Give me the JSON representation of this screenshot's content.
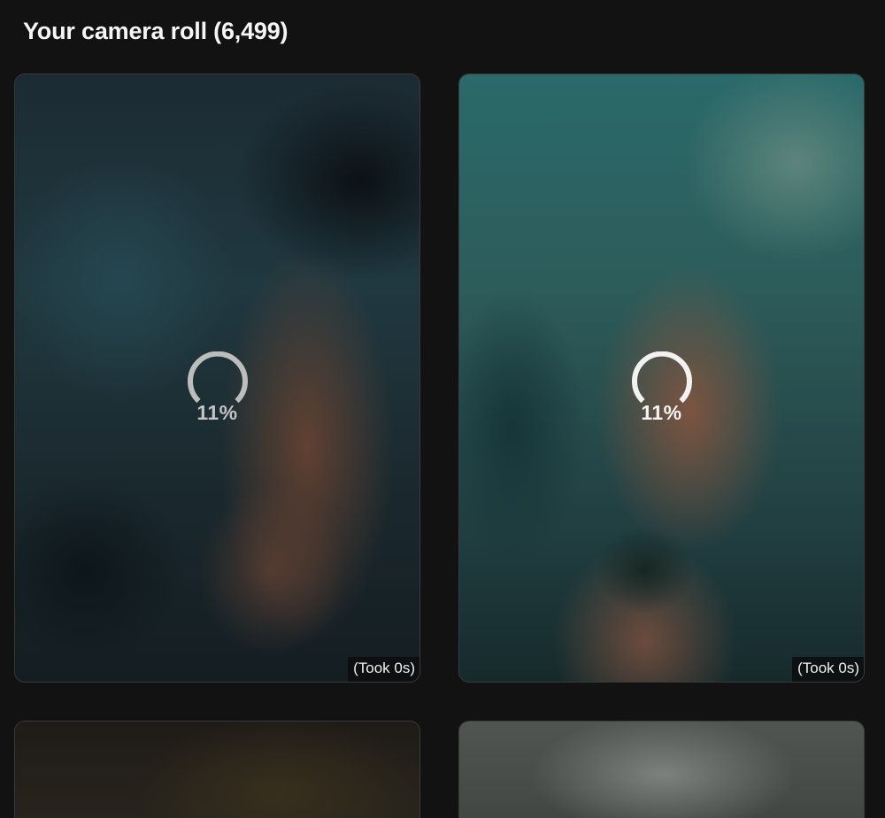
{
  "header": {
    "title": "Your camera roll (6,499)"
  },
  "gallery": {
    "items": [
      {
        "progress_label": "11%",
        "progress_value": 0.11,
        "duration_label": "(Took 0s)",
        "state": "loading"
      },
      {
        "progress_label": "11%",
        "progress_value": 0.11,
        "duration_label": "(Took 0s)",
        "state": "loading"
      },
      {
        "state": "partially-visible"
      },
      {
        "state": "partially-visible"
      }
    ]
  },
  "icons": {
    "spinner": "loading-spinner-icon"
  },
  "colors": {
    "background": "#121212",
    "tile_border": "#3a3a3a",
    "text": "#ffffff",
    "badge_background": "#0e0e0e"
  }
}
